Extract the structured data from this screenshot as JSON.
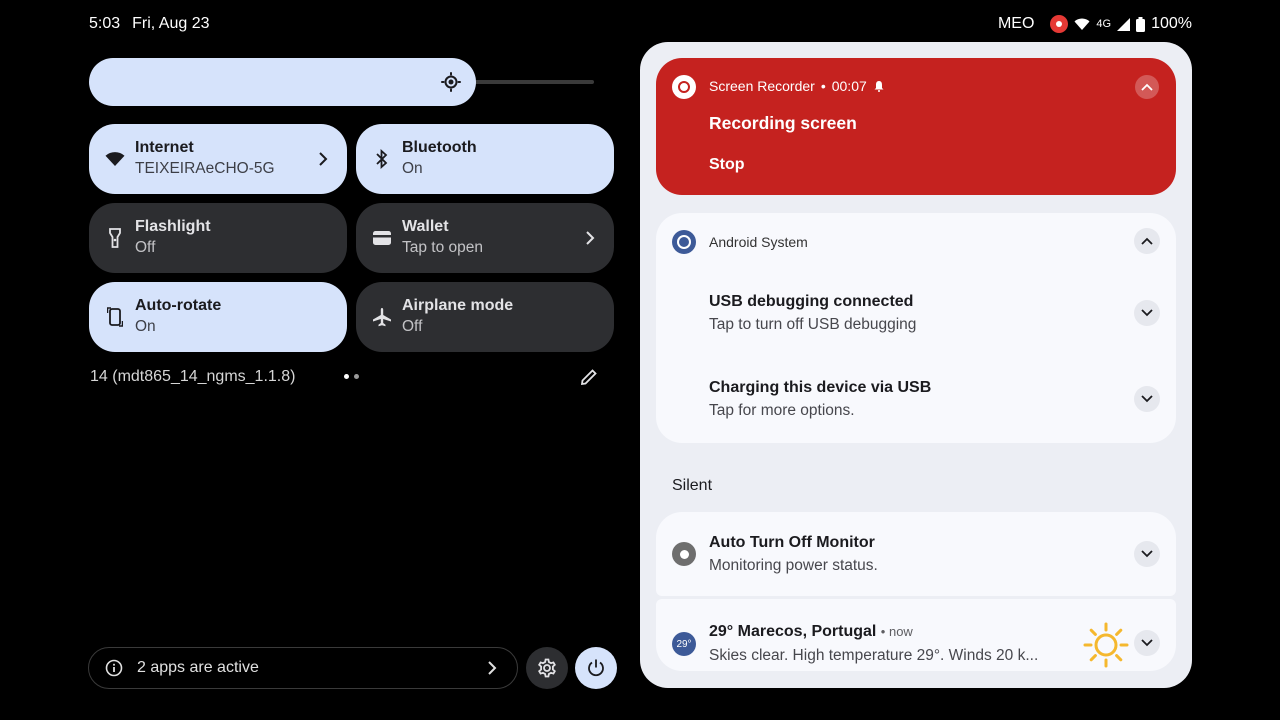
{
  "status_bar": {
    "time": "5:03",
    "date": "Fri, Aug 23",
    "carrier": "MEO",
    "network": "4G",
    "battery": "100%"
  },
  "brightness": {
    "level": 0.75
  },
  "tiles": [
    {
      "label": "Internet",
      "sub": "TEIXEIRAeCHO-5G",
      "state": "on",
      "icon": "wifi-icon"
    },
    {
      "label": "Bluetooth",
      "sub": "On",
      "state": "on",
      "icon": "bluetooth-icon"
    },
    {
      "label": "Flashlight",
      "sub": "Off",
      "state": "off",
      "icon": "flashlight-icon"
    },
    {
      "label": "Wallet",
      "sub": "Tap to open",
      "state": "off",
      "icon": "wallet-icon"
    },
    {
      "label": "Auto-rotate",
      "sub": "On",
      "state": "on",
      "icon": "rotate-icon"
    },
    {
      "label": "Airplane mode",
      "sub": "Off",
      "state": "off",
      "icon": "airplane-icon"
    }
  ],
  "build": "14 (mdt865_14_ngms_1.1.8)",
  "apps_active": "2 apps are active",
  "notifications": {
    "recorder": {
      "app": "Screen Recorder",
      "timer": "00:07",
      "title": "Recording screen",
      "action": "Stop"
    },
    "system": {
      "app": "Android System",
      "items": [
        {
          "title": "USB debugging connected",
          "text": "Tap to turn off USB debugging"
        },
        {
          "title": "Charging this device via USB",
          "text": "Tap for more options."
        }
      ]
    },
    "silent_header": "Silent",
    "monitor": {
      "title": "Auto Turn Off Monitor",
      "text": "Monitoring power status."
    },
    "weather": {
      "badge": "29°",
      "title": "29° Marecos, Portugal",
      "time": "now",
      "text": "Skies clear. High temperature 29°. Winds 20 k..."
    }
  },
  "colors": {
    "tile_on": "#d6e3fb",
    "tile_off": "#2d2e31",
    "recorder_red": "#c5221f",
    "shade_bg": "#eceef4"
  }
}
